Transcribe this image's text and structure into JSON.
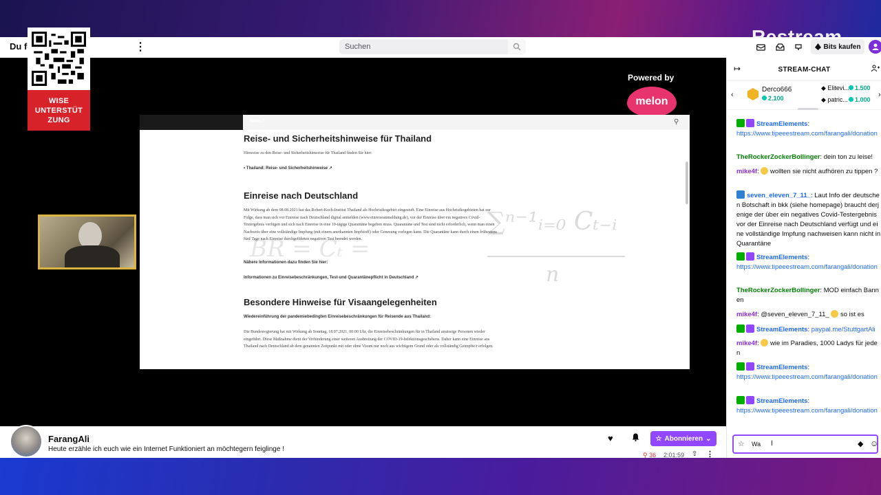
{
  "overlay": {
    "brand": "Restream",
    "qr_caption": "WISE UNTERSTÜT ZUNG",
    "powered_by": "Powered by",
    "sponsor": "melon"
  },
  "nav": {
    "title": "Du fo... suchen",
    "search_placeholder": "Suchen",
    "bits_label": "Bits kaufen"
  },
  "screen_share": {
    "menu_label": "INHALT",
    "heading1": "Reise- und Sicherheitshinweise für Thailand",
    "p1": "Hinweise zu den Reise- und Sicherheitshinweise für Thailand finden Sie hier:",
    "bullet1": "Thailand: Reise- und Sicherheitshinweise",
    "heading2": "Einreise nach Deutschland",
    "p2": "Mit Wirkung ab dem 08.08.2021 hat das Robert-Koch-Institut Thailand als Hochrisikogebiet eingestuft. Eine Einreise aus Hochrisikogebieten hat zur Folge, dass man sich vor Einreise nach Deutschland digital anmelden (www.einreiseanmeldung.de), vor der Einreise über ein negatives Covid-Testergebnis verfügen und sich nach Einreise in eine 10-tägige Quarantäne begeben muss. Quarantäne und Test sind nicht erforderlich, wenn man einen Nachweis über eine vollständige Impfung (mit einem anerkannten Impfstoff) oder Genesung vorlegen kann. Die Quarantäne kann durch einen frühestens fünf Tage nach Einreise durchgeführten negativen Test beendet werden.",
    "bold1": "Nähere Informationen dazu finden Sie hier:",
    "link1": "Informationen zu Einreisebeschränkungen, Test-und Quarantänepflicht in Deutschland",
    "heading3": "Besondere Hinweise für Visaangelegenheiten",
    "bold2": "Wiedereinführung der pandemiebedingten Einreisebeschränkungen für Reisende aus Thailand:",
    "p3": "Die Bundesregierung hat mit Wirkung ab Sonntag, 18.07.2021, 00:00 Uhr, die Einreisebeschränkungen für in Thailand ansässige Personen wieder eingeführt. Diese Maßnahme dient der Verhinderung einer weiteren Ausbreitung der COVID-19-Infektionsgeschehens. Daher kann eine Einreise aus Thailand nach Deutschland ab dem genannten Zeitpunkt mit oder ohne Visum nur noch aus wichtigem Grund oder als vollständig Geimpfte/r erfolgen.",
    "formula_top": "∑ⁿ⁻¹ᵢ₌₀ Cₜ₋ᵢ",
    "formula_eq": "BR = Cₜ =",
    "formula_n": "n"
  },
  "stream": {
    "streamer": "FarangAli",
    "title": "Heute erzähle ich euch wie ein Internet Funktioniert an möchtegern feiglinge !",
    "subscribe_label": "Abonnieren",
    "viewers": "36",
    "uptime": "2:01:59"
  },
  "chat": {
    "header": "STREAM-CHAT",
    "leaderboard": [
      {
        "name": "Derco666",
        "amount": "2.100"
      },
      {
        "name": "Elitevi...",
        "amount": "1.500"
      },
      {
        "name": "patric...",
        "amount": "1.000"
      }
    ],
    "messages": [
      {
        "user": "StreamElements",
        "sep": ": ",
        "text": "https://www.tipeeestream.com/farangali/donation"
      },
      {
        "user": "TheRockerZockerBollinger",
        "sep": ": ",
        "text": "dein ton zu leise!"
      },
      {
        "user": "mike4f",
        "sep": ": ",
        "text": "wollten sie nicht aufhören zu tippen ?"
      },
      {
        "user": "seven_eleven_7_11_",
        "sep": ": ",
        "text": "Laut Info der deutschen Botschaft in bkk (siehe homepage) braucht derjenige der über ein negatives Covid-Testergebnis vor der Einreise nach Deutschland verfügt und eine vollständige Impfung nachweisen kann nicht in Quarantäne"
      },
      {
        "user": "StreamElements",
        "sep": ": ",
        "text": "https://www.tipeeestream.com/farangali/donation"
      },
      {
        "user": "TheRockerZockerBollinger",
        "sep": ": ",
        "text": "MOD einfach Bannen"
      },
      {
        "user": "mike4f",
        "sep": ": ",
        "text": "@seven_eleven_7_11_",
        "text2": "so ist es"
      },
      {
        "user": "StreamElements",
        "sep": ": ",
        "text": "paypal.me/StuttgartAli"
      },
      {
        "user": "mike4f",
        "sep": ": ",
        "text": "wie im Paradies, 1000 Ladys für jeden"
      },
      {
        "user": "StreamElements",
        "sep": ": ",
        "text": "https://www.tipeeestream.com/farangali/donation"
      },
      {
        "user": "StreamElements",
        "sep": ": ",
        "text": "https://www.tipeeestream.com/farangali/donation"
      }
    ],
    "input_value": "Wa"
  },
  "colors": {
    "accent": "#9147ff",
    "qr_label_bg": "#d8222a",
    "melon": "#e8346e",
    "webcam_border": "#d9b441"
  }
}
